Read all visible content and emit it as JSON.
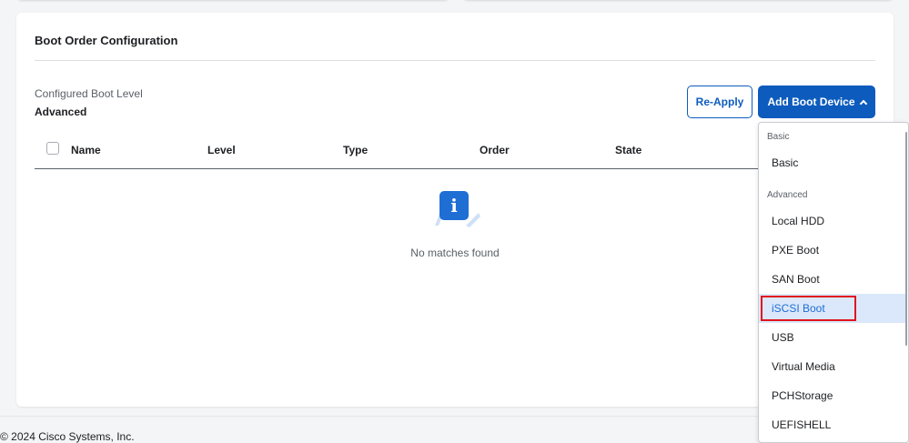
{
  "card": {
    "title": "Boot Order Configuration",
    "configured_label": "Configured Boot Level",
    "configured_value": "Advanced"
  },
  "buttons": {
    "reapply": "Re-Apply",
    "add_boot_device": "Add Boot Device"
  },
  "table": {
    "columns": [
      "Name",
      "Level",
      "Type",
      "Order",
      "State"
    ],
    "empty_text": "No matches found"
  },
  "dropdown": {
    "groups": [
      {
        "label": "Basic",
        "items": [
          "Basic"
        ]
      },
      {
        "label": "Advanced",
        "items": [
          "Local HDD",
          "PXE Boot",
          "SAN Boot",
          "iSCSI Boot",
          "USB",
          "Virtual Media",
          "PCHStorage",
          "UEFISHELL"
        ]
      }
    ],
    "selected": "iSCSI Boot"
  },
  "footer": {
    "copyright": "© 2024 Cisco Systems, Inc."
  },
  "colors": {
    "primary": "#0d5cbd",
    "highlight_border": "#e0141e",
    "selected_bg": "#dbe8fb"
  }
}
